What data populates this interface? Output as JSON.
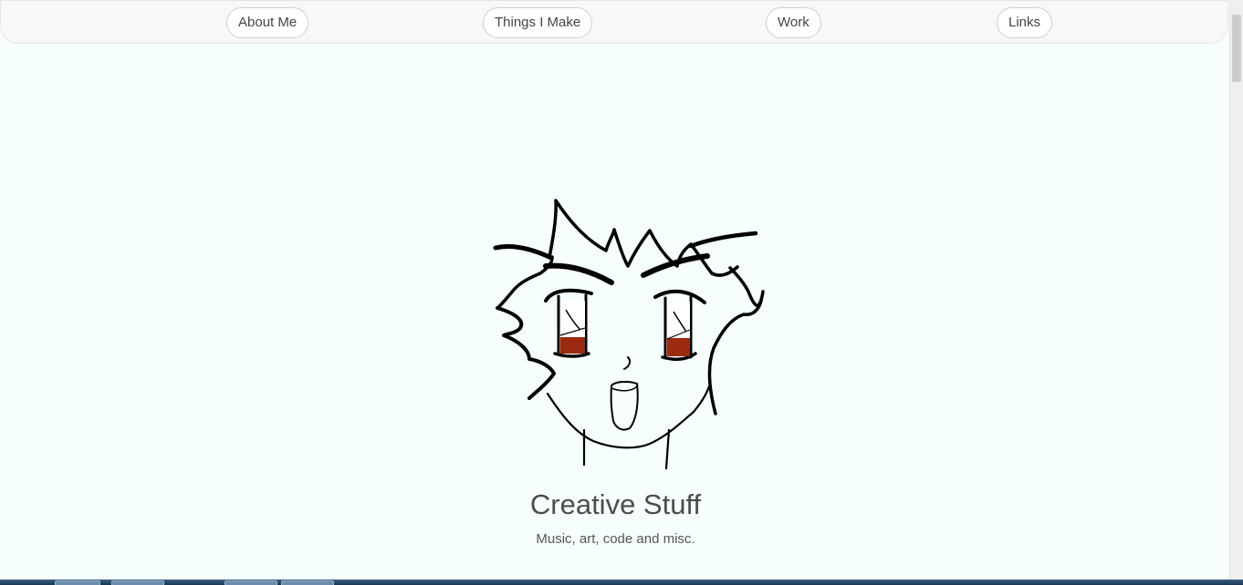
{
  "nav": {
    "items": [
      {
        "label": "About Me"
      },
      {
        "label": "Things I Make"
      },
      {
        "label": "Work"
      },
      {
        "label": "Links"
      }
    ]
  },
  "hero": {
    "title": "Creative Stuff",
    "subtitle": "Music, art, code and misc."
  },
  "colors": {
    "background": "#f6fffe",
    "text": "#4d4d4d",
    "eye_iris": "#9b2a10"
  }
}
